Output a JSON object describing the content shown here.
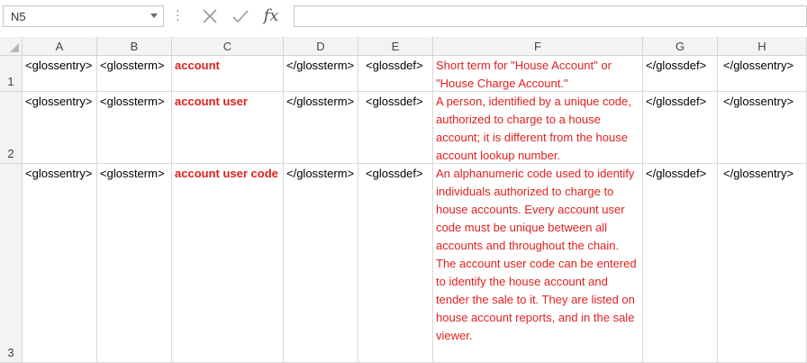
{
  "formula_bar": {
    "name_box": "N5",
    "cancel_icon": "close-icon",
    "enter_icon": "check-icon",
    "function_label": "fx",
    "formula_value": ""
  },
  "grid": {
    "columns": [
      "A",
      "B",
      "C",
      "D",
      "E",
      "F",
      "G",
      "H"
    ],
    "rows": [
      {
        "num": "1",
        "cells": [
          "<glossentry>",
          "<glossterm>",
          "account",
          "</glossterm>",
          "<glossdef>",
          "Short term for \"House Account\" or \"House Charge Account.\"",
          "</glossdef>",
          "</glossentry>"
        ]
      },
      {
        "num": "2",
        "cells": [
          "<glossentry>",
          "<glossterm>",
          "account user",
          "</glossterm>",
          "<glossdef>",
          "A person, identified by a unique code, authorized to charge to a house account; it is different from the house account lookup number.",
          "</glossdef>",
          "</glossentry>"
        ]
      },
      {
        "num": "3",
        "cells": [
          "<glossentry>",
          "<glossterm>",
          "account user code",
          "</glossterm>",
          "<glossdef>",
          "An alphanumeric code used to identify individuals authorized to charge to house accounts. Every account user code must be unique between all accounts and throughout the chain. The account user code can be entered to identify the house account and tender the sale to it. They are listed on house account reports, and in the sale viewer.",
          "</glossdef>",
          "</glossentry>"
        ]
      }
    ],
    "colors": {
      "red_text": "#e02020",
      "header_bg": "#f3f3f3",
      "grid_line": "#d9d9d9"
    }
  }
}
